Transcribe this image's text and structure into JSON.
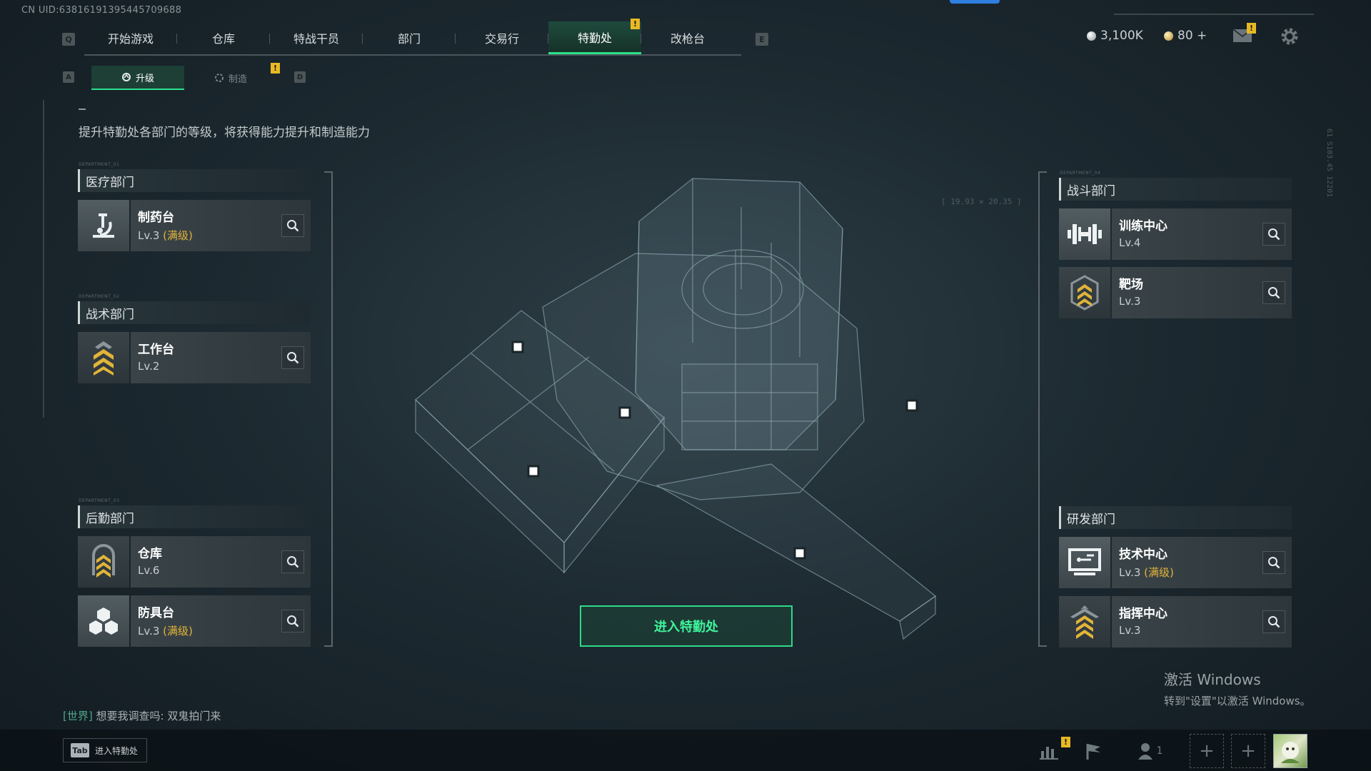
{
  "uid": "CN UID:63816191395445709688",
  "nav": {
    "left_key": "Q",
    "right_key": "E",
    "tabs": [
      {
        "label": "开始游戏",
        "active": false,
        "warn": false
      },
      {
        "label": "仓库",
        "active": false,
        "warn": false
      },
      {
        "label": "特战干员",
        "active": false,
        "warn": false
      },
      {
        "label": "部门",
        "active": false,
        "warn": false
      },
      {
        "label": "交易行",
        "active": false,
        "warn": false
      },
      {
        "label": "特勤处",
        "active": true,
        "warn": true
      },
      {
        "label": "改枪台",
        "active": false,
        "warn": false
      }
    ]
  },
  "currency": {
    "silver": "3,100K",
    "gold": "80 +",
    "silver_color": "#c7cdd0",
    "gold_color": "#d8b35a"
  },
  "warn_mark": "!",
  "subtabs": {
    "left_key": "A",
    "right_key": "D",
    "upgrade": "升级",
    "craft": "制造"
  },
  "description": "提升特勤处各部门的等级，将获得能力提升和制造能力",
  "departments": {
    "medical": {
      "tag": "DEPARTMENT_01",
      "title": "医疗部门",
      "items": [
        {
          "name": "制药台",
          "level": "Lv.3",
          "max": "(满级)",
          "icon": "microscope-icon"
        }
      ]
    },
    "tactical": {
      "tag": "DEPARTMENT_02",
      "title": "战术部门",
      "items": [
        {
          "name": "工作台",
          "level": "Lv.2",
          "max": "",
          "icon": "rank-chevron-icon"
        }
      ]
    },
    "logistics": {
      "tag": "DEPARTMENT_03",
      "title": "后勤部门",
      "items": [
        {
          "name": "仓库",
          "level": "Lv.6",
          "max": "",
          "icon": "rank-chevron-icon"
        },
        {
          "name": "防具台",
          "level": "Lv.3",
          "max": "(满级)",
          "icon": "cubes-icon"
        }
      ]
    },
    "combat": {
      "tag": "DEPARTMENT_04",
      "title": "战斗部门",
      "items": [
        {
          "name": "训练中心",
          "level": "Lv.4",
          "max": "",
          "icon": "dumbbell-icon"
        },
        {
          "name": "靶场",
          "level": "Lv.3",
          "max": "",
          "icon": "rank-chevron-icon"
        }
      ]
    },
    "research": {
      "title": "研发部门",
      "items": [
        {
          "name": "技术中心",
          "level": "Lv.3",
          "max": "(满级)",
          "icon": "monitor-icon"
        },
        {
          "name": "指挥中心",
          "level": "Lv.3",
          "max": "",
          "icon": "rank-chevron-icon"
        }
      ]
    }
  },
  "enter_button": "进入特勤处",
  "hud": {
    "coords": "[ 19.93 × 20.35 ]",
    "side_code": "61 S103.45 12201"
  },
  "chat": {
    "channel": "[世界]",
    "message": "想要我调查吗: 双鬼拍门来"
  },
  "bottom": {
    "tab_key": "Tab",
    "tab_label": "进入特勤处",
    "friends_count": "1"
  },
  "watermark": {
    "line1": "激活 Windows",
    "line2": "转到\"设置\"以激活 Windows。"
  },
  "accent_color": "#2ee08a",
  "max_color": "#e5b43a"
}
